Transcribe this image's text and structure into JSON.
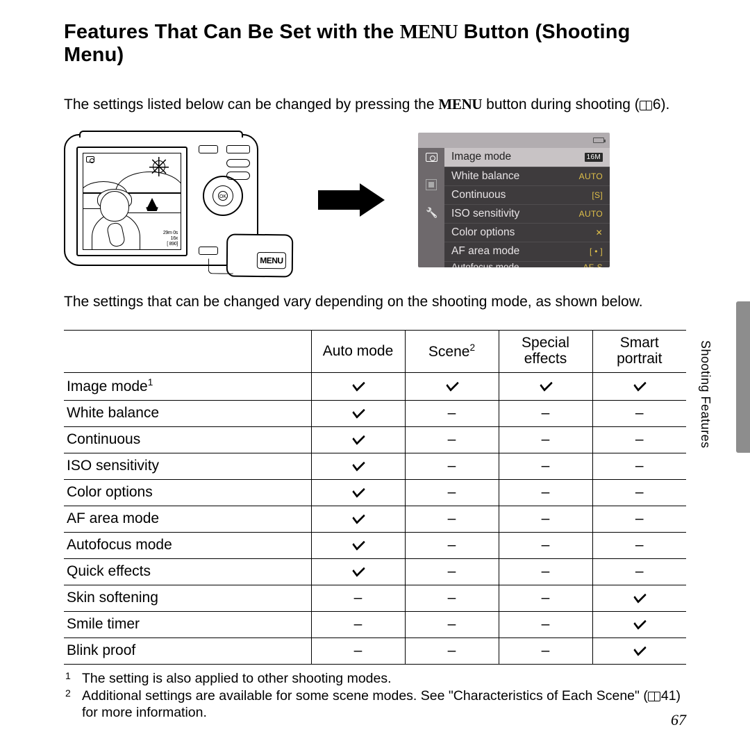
{
  "title": {
    "prefix": "Features That Can Be Set with the ",
    "menu_word": "MENU",
    "suffix": " Button (Shooting Menu)"
  },
  "intro": {
    "prefix": "The settings listed below can be changed by pressing the ",
    "menu_word": "MENU",
    "suffix": " button during shooting (",
    "page_ref": "6",
    "suffix2": ")."
  },
  "camera_screen": {
    "overlay_lines": "29m 0s\n16x\n[ 890]"
  },
  "menu_callout_label": "MENU",
  "camera_wheel_label": "OK",
  "menu_panel": {
    "items": [
      {
        "label": "Image mode",
        "value": "16M",
        "selected": true
      },
      {
        "label": "White balance",
        "value": "AUTO"
      },
      {
        "label": "Continuous",
        "value": "[S]"
      },
      {
        "label": "ISO sensitivity",
        "value": "AUTO"
      },
      {
        "label": "Color options",
        "value": "✕"
      },
      {
        "label": "AF area mode",
        "value": "[ • ]"
      },
      {
        "label": "Autofocus mode",
        "value": "AF-S"
      }
    ]
  },
  "mid_text": "The settings that can be changed vary depending on the shooting mode, as shown below.",
  "table": {
    "headers": [
      "Auto mode",
      "Scene",
      "Special effects",
      "Smart portrait"
    ],
    "header_sup": {
      "1": "2"
    },
    "rows": [
      {
        "label": "Image mode",
        "sup": "1",
        "cells": [
          "check",
          "check",
          "check",
          "check"
        ]
      },
      {
        "label": "White balance",
        "cells": [
          "check",
          "dash",
          "dash",
          "dash"
        ]
      },
      {
        "label": "Continuous",
        "cells": [
          "check",
          "dash",
          "dash",
          "dash"
        ]
      },
      {
        "label": "ISO sensitivity",
        "cells": [
          "check",
          "dash",
          "dash",
          "dash"
        ]
      },
      {
        "label": "Color options",
        "cells": [
          "check",
          "dash",
          "dash",
          "dash"
        ]
      },
      {
        "label": "AF area mode",
        "cells": [
          "check",
          "dash",
          "dash",
          "dash"
        ]
      },
      {
        "label": "Autofocus mode",
        "cells": [
          "check",
          "dash",
          "dash",
          "dash"
        ]
      },
      {
        "label": "Quick effects",
        "cells": [
          "check",
          "dash",
          "dash",
          "dash"
        ]
      },
      {
        "label": "Skin softening",
        "cells": [
          "dash",
          "dash",
          "dash",
          "check"
        ]
      },
      {
        "label": "Smile timer",
        "cells": [
          "dash",
          "dash",
          "dash",
          "check"
        ]
      },
      {
        "label": "Blink proof",
        "cells": [
          "dash",
          "dash",
          "dash",
          "check"
        ]
      }
    ]
  },
  "footnotes": [
    {
      "num": "1",
      "text": "The setting is also applied to other shooting modes."
    },
    {
      "num": "2",
      "text": "Additional settings are available for some scene modes. See \"Characteristics of Each Scene\" (📖41) for more information."
    }
  ],
  "fn2_prefix": "Additional settings are available for some scene modes. See \"Characteristics of Each Scene\" (",
  "fn2_ref": "41",
  "fn2_suffix": ") for more information.",
  "side_label": "Shooting Features",
  "page_number": "67",
  "dash_char": "–"
}
